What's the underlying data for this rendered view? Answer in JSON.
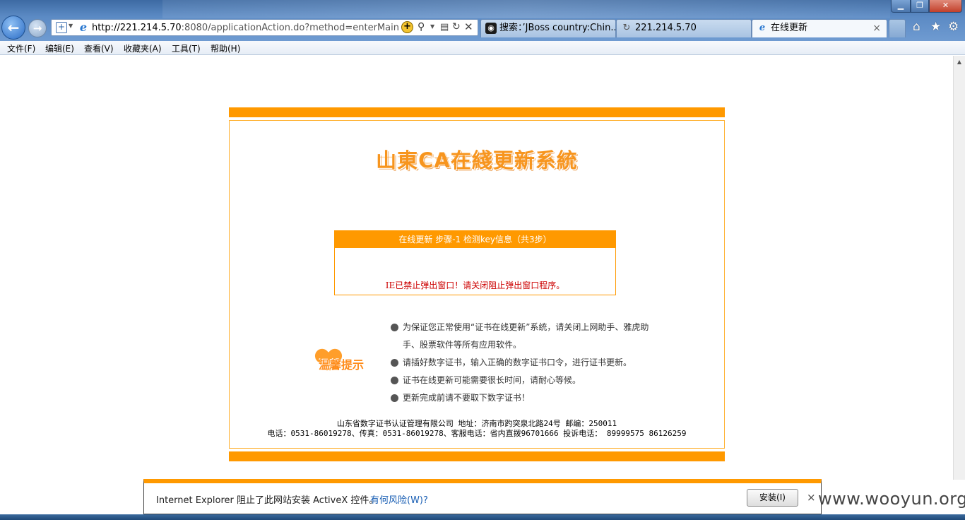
{
  "window": {
    "minimize_glyph": "▁",
    "maximize_glyph": "❐",
    "close_glyph": "✕"
  },
  "nav": {
    "back_glyph": "←",
    "forward_glyph": "→"
  },
  "address_bar": {
    "url_host": "http://221.214.5.70",
    "url_rest": ":8080/applicationAction.do?method=enterMain"
  },
  "tabs": [
    {
      "label": "搜索：’JBoss country:Chin...",
      "icon": "eye-icon"
    },
    {
      "label": "221.214.5.70",
      "icon": "loading-icon"
    },
    {
      "label": "在线更新",
      "icon": "ie-icon",
      "close": "×"
    }
  ],
  "menu": {
    "items": [
      "文件(F)",
      "编辑(E)",
      "查看(V)",
      "收藏夹(A)",
      "工具(T)",
      "帮助(H)"
    ]
  },
  "page": {
    "logo_title": "山東CA在綫更新系統",
    "step": {
      "header": "在线更新 步骤-1 检测key信息（共3步）",
      "message": "IE已禁止弹出窗口！请关闭阻止弹出窗口程序。"
    },
    "tips_badge": "温馨提示",
    "tips": [
      "为保证您正常使用“证书在线更新”系统，请关闭上网助手、雅虎助手、股票软件等所有应用软件。",
      "请插好数字证书，输入正确的数字证书口令，进行证书更新。",
      "证书在线更新可能需要很长时间，请耐心等候。",
      "更新完成前请不要取下数字证书！"
    ],
    "footer": {
      "line1": "山东省数字证书认证管理有限公司 地址：济南市趵突泉北路24号 邮编：250011",
      "line2": "电话：0531-86019278、传真：0531-86019278、客服电话：省内直拨96701666 投诉电话： 89999575 86126259"
    }
  },
  "notification": {
    "text": "Internet Explorer 阻止了此网站安装 ActiveX 控件。",
    "link": "有何风险(W)?",
    "install_label": "安装(I)",
    "close_glyph": "×"
  },
  "watermark": "www.wooyun.org",
  "colors": {
    "accent_orange": "#ff9900",
    "error_red": "#cc0000",
    "chrome_blue": "#5b8ac4"
  }
}
